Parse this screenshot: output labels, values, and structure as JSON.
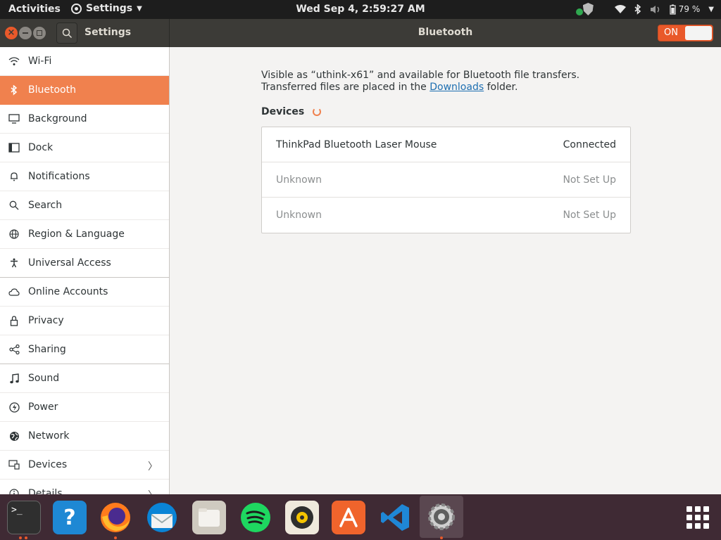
{
  "topbar": {
    "activities": "Activities",
    "app_name": "Settings",
    "clock": "Wed Sep  4,  2:59:27 AM",
    "battery": "79 %"
  },
  "header": {
    "sidebar_title": "Settings",
    "panel_title": "Bluetooth",
    "toggle_label": "ON"
  },
  "sidebar": {
    "items": [
      {
        "label": "Wi-Fi",
        "icon": "wifi-icon"
      },
      {
        "label": "Bluetooth",
        "icon": "bluetooth-icon"
      },
      {
        "label": "Background",
        "icon": "monitor-icon"
      },
      {
        "label": "Dock",
        "icon": "dock-icon"
      },
      {
        "label": "Notifications",
        "icon": "bell-icon"
      },
      {
        "label": "Search",
        "icon": "search-icon"
      },
      {
        "label": "Region & Language",
        "icon": "globe-icon"
      },
      {
        "label": "Universal Access",
        "icon": "accessibility-icon"
      },
      {
        "label": "Online Accounts",
        "icon": "cloud-icon"
      },
      {
        "label": "Privacy",
        "icon": "lock-icon"
      },
      {
        "label": "Sharing",
        "icon": "share-icon"
      },
      {
        "label": "Sound",
        "icon": "music-note-icon"
      },
      {
        "label": "Power",
        "icon": "power-icon"
      },
      {
        "label": "Network",
        "icon": "network-icon"
      },
      {
        "label": "Devices",
        "icon": "devices-icon"
      },
      {
        "label": "Details",
        "icon": "info-icon"
      }
    ]
  },
  "main": {
    "desc_prefix": "Visible as “uthink-x61” and available for Bluetooth file transfers. Transferred files are placed in the ",
    "desc_link": "Downloads",
    "desc_suffix": " folder.",
    "devices_label": "Devices",
    "devices": [
      {
        "name": "ThinkPad Bluetooth Laser Mouse",
        "status": "Connected"
      },
      {
        "name": "Unknown",
        "status": "Not Set Up"
      },
      {
        "name": "Unknown",
        "status": "Not Set Up"
      }
    ]
  },
  "dock": {
    "apps": [
      "terminal-icon",
      "help-icon",
      "firefox-icon",
      "thunderbird-icon",
      "files-icon",
      "spotify-icon",
      "rhythmbox-icon",
      "software-center-icon",
      "vscode-icon",
      "settings-icon"
    ]
  },
  "colors": {
    "accent": "#f0814e",
    "header_bg": "#3c3b37",
    "dock_bg": "#3f2a34"
  }
}
